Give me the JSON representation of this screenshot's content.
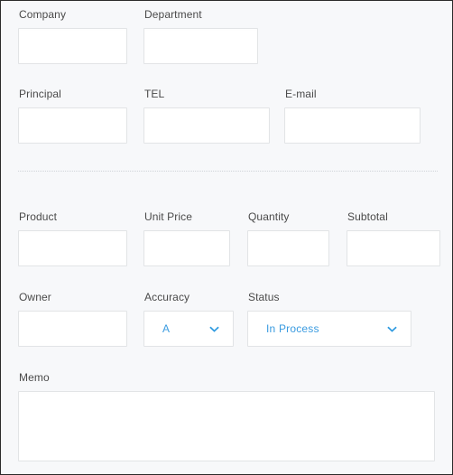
{
  "form": {
    "background_color": "#f7f8fa",
    "accent_color": "#2e9ae0",
    "label_color": "#4a4a4a",
    "border_color": "#e2e4e6",
    "sections": [
      {
        "name": "contact",
        "fields": [
          {
            "key": "company",
            "label": "Company",
            "value": "",
            "placeholder": "",
            "type": "text"
          },
          {
            "key": "department",
            "label": "Department",
            "value": "",
            "placeholder": "",
            "type": "text"
          },
          {
            "key": "principal",
            "label": "Principal",
            "value": "",
            "placeholder": "",
            "type": "text"
          },
          {
            "key": "tel",
            "label": "TEL",
            "value": "",
            "placeholder": "",
            "type": "text"
          },
          {
            "key": "email",
            "label": "E-mail",
            "value": "",
            "placeholder": "",
            "type": "text"
          }
        ]
      },
      {
        "name": "order",
        "fields": [
          {
            "key": "product",
            "label": "Product",
            "value": "",
            "placeholder": "",
            "type": "text"
          },
          {
            "key": "unitprice",
            "label": "Unit Price",
            "value": "",
            "placeholder": "",
            "type": "text"
          },
          {
            "key": "quantity",
            "label": "Quantity",
            "value": "",
            "placeholder": "",
            "type": "text"
          },
          {
            "key": "subtotal",
            "label": "Subtotal",
            "value": "",
            "placeholder": "",
            "type": "text"
          },
          {
            "key": "owner",
            "label": "Owner",
            "value": "",
            "placeholder": "",
            "type": "text"
          },
          {
            "key": "accuracy",
            "label": "Accuracy",
            "value": "A",
            "type": "select"
          },
          {
            "key": "status",
            "label": "Status",
            "value": "In Process",
            "type": "select"
          },
          {
            "key": "memo",
            "label": "Memo",
            "value": "",
            "placeholder": "",
            "type": "textarea"
          }
        ]
      }
    ],
    "labels": {
      "company": "Company",
      "department": "Department",
      "principal": "Principal",
      "tel": "TEL",
      "email": "E-mail",
      "product": "Product",
      "unitprice": "Unit Price",
      "quantity": "Quantity",
      "subtotal": "Subtotal",
      "owner": "Owner",
      "accuracy": "Accuracy",
      "status": "Status",
      "memo": "Memo"
    },
    "values": {
      "company": "",
      "department": "",
      "principal": "",
      "tel": "",
      "email": "",
      "product": "",
      "unitprice": "",
      "quantity": "",
      "subtotal": "",
      "owner": "",
      "accuracy": "A",
      "status": "In Process",
      "memo": ""
    },
    "placeholders": {
      "company": "",
      "department": "",
      "principal": "",
      "tel": "",
      "email": "",
      "product": "",
      "unitprice": "",
      "quantity": "",
      "subtotal": "",
      "owner": "",
      "memo": ""
    },
    "icons": {
      "accuracy_toggle": "chevron-down-icon",
      "status_toggle": "chevron-down-icon"
    }
  }
}
